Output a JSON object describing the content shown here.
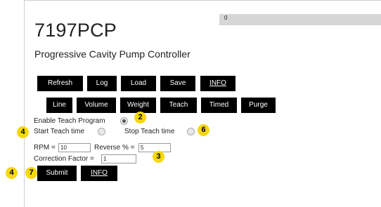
{
  "progress": {
    "text": "0",
    "value_percent": 0
  },
  "header": {
    "title": "7197PCP",
    "subtitle": "Progressive Cavity Pump Controller"
  },
  "toolbar": {
    "refresh": "Refresh",
    "log": "Log",
    "load": "Load",
    "save": "Save",
    "info": "INFO"
  },
  "modes": {
    "line": "Line",
    "volume": "Volume",
    "weight": "Weight",
    "teach": "Teach",
    "timed": "Timed",
    "purge": "Purge"
  },
  "teach_form": {
    "enable_label": "Enable Teach Program",
    "start_label": "Start Teach time",
    "stop_label": "Stop Teach time",
    "rpm_label": "RPM =",
    "rpm_value": "10",
    "reverse_label": "Reverse % =",
    "reverse_value": "5",
    "correction_label": "Correction Factor =",
    "correction_value": "1",
    "submit": "Submit",
    "info": "INFO"
  },
  "annotations": {
    "b2": "2",
    "b4a": "4",
    "b6": "6",
    "b3": "3",
    "b4b": "4",
    "b7": "7",
    "color": "#f5d90a"
  }
}
